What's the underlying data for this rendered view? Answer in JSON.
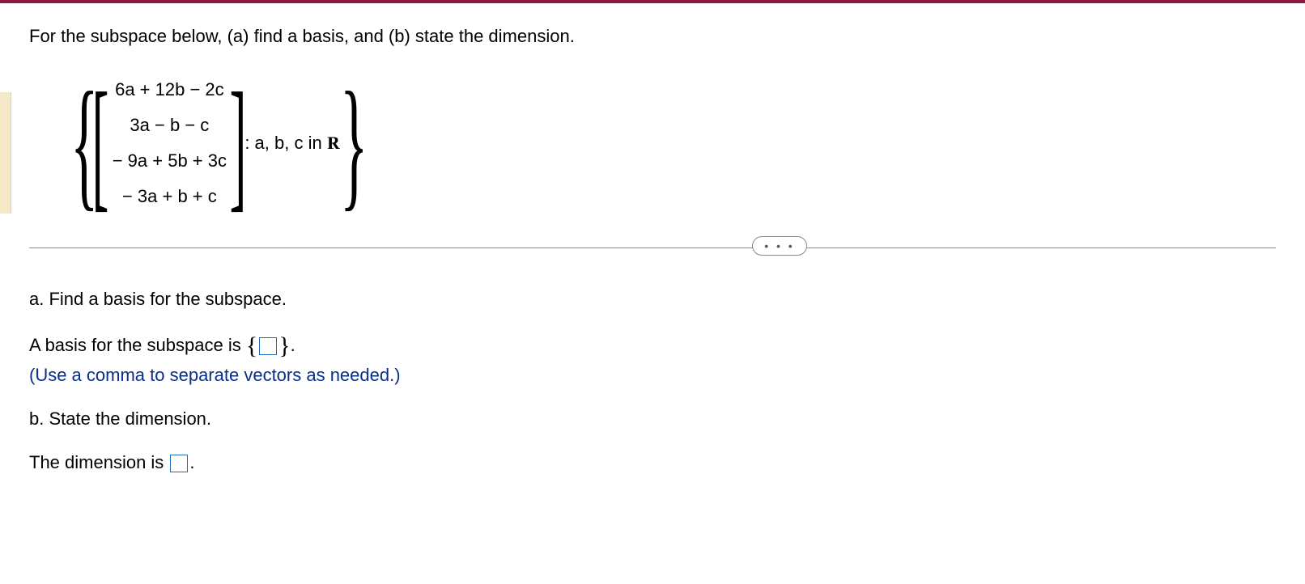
{
  "question": {
    "prompt": "For the subspace below, (a) find a basis, and (b) state the dimension.",
    "vector": {
      "row1": "6a + 12b − 2c",
      "row2": "3a − b − c",
      "row3": "− 9a + 5b + 3c",
      "row4": "− 3a + b + c"
    },
    "condition_prefix": ": a, b, c in ",
    "condition_set": "R"
  },
  "divider": {
    "more_label": "• • •"
  },
  "parts": {
    "a": {
      "heading": "a. Find a basis for the subspace.",
      "answer_prefix": "A basis for the subspace is ",
      "brace_open": "{",
      "brace_close": "}",
      "period": ".",
      "hint": "(Use a comma to separate vectors as needed.)"
    },
    "b": {
      "heading": "b. State the dimension.",
      "answer_prefix": "The dimension is ",
      "period": "."
    }
  }
}
